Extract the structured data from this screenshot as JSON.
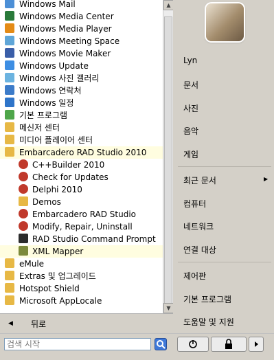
{
  "colors": {
    "highlight": "#fffde0",
    "folder": "#e7b845",
    "blue_icon": "#2e74c9",
    "red_icon": "#c0392b"
  },
  "programs": [
    {
      "label": "Windows Mail",
      "icon": "mail-icon"
    },
    {
      "label": "Windows Media Center",
      "icon": "media-center-icon"
    },
    {
      "label": "Windows Media Player",
      "icon": "media-player-icon"
    },
    {
      "label": "Windows Meeting Space",
      "icon": "meeting-space-icon"
    },
    {
      "label": "Windows Movie Maker",
      "icon": "movie-maker-icon"
    },
    {
      "label": "Windows Update",
      "icon": "windows-update-icon"
    },
    {
      "label": "Windows 사진 갤러리",
      "icon": "photo-gallery-icon"
    },
    {
      "label": "Windows 연락처",
      "icon": "contacts-icon"
    },
    {
      "label": "Windows 일정",
      "icon": "calendar-icon"
    },
    {
      "label": "기본 프로그램",
      "icon": "default-programs-icon"
    },
    {
      "label": "메신저 센터",
      "icon": "messenger-icon"
    },
    {
      "label": "미디어 플레이어 센터",
      "icon": "media-player-center-icon"
    },
    {
      "label": "Embarcadero RAD Studio 2010",
      "icon": "folder-icon"
    },
    {
      "label": "C++Builder 2010",
      "icon": "rad-studio-icon"
    },
    {
      "label": "Check for Updates",
      "icon": "rad-studio-icon"
    },
    {
      "label": "Delphi 2010",
      "icon": "rad-studio-icon"
    },
    {
      "label": "Demos",
      "icon": "folder-icon"
    },
    {
      "label": "Embarcadero RAD Studio",
      "icon": "rad-studio-icon"
    },
    {
      "label": "Modify, Repair, Uninstall",
      "icon": "rad-studio-icon"
    },
    {
      "label": "RAD Studio Command Prompt",
      "icon": "command-prompt-icon"
    },
    {
      "label": "XML Mapper",
      "icon": "xml-mapper-icon"
    },
    {
      "label": "eMule",
      "icon": "folder-icon"
    },
    {
      "label": "Extras 및 업그레이드",
      "icon": "folder-icon"
    },
    {
      "label": "Hotspot Shield",
      "icon": "folder-icon"
    },
    {
      "label": "Microsoft AppLocale",
      "icon": "folder-icon"
    }
  ],
  "back_label": "뒤로",
  "right_menu": [
    "Lyn",
    "문서",
    "사진",
    "음악",
    "게임",
    "최근 문서",
    "컴퓨터",
    "네트워크",
    "연결 대상",
    "제어판",
    "기본 프로그램",
    "도움말 및 지원"
  ],
  "search": {
    "placeholder": "검색 시작"
  }
}
